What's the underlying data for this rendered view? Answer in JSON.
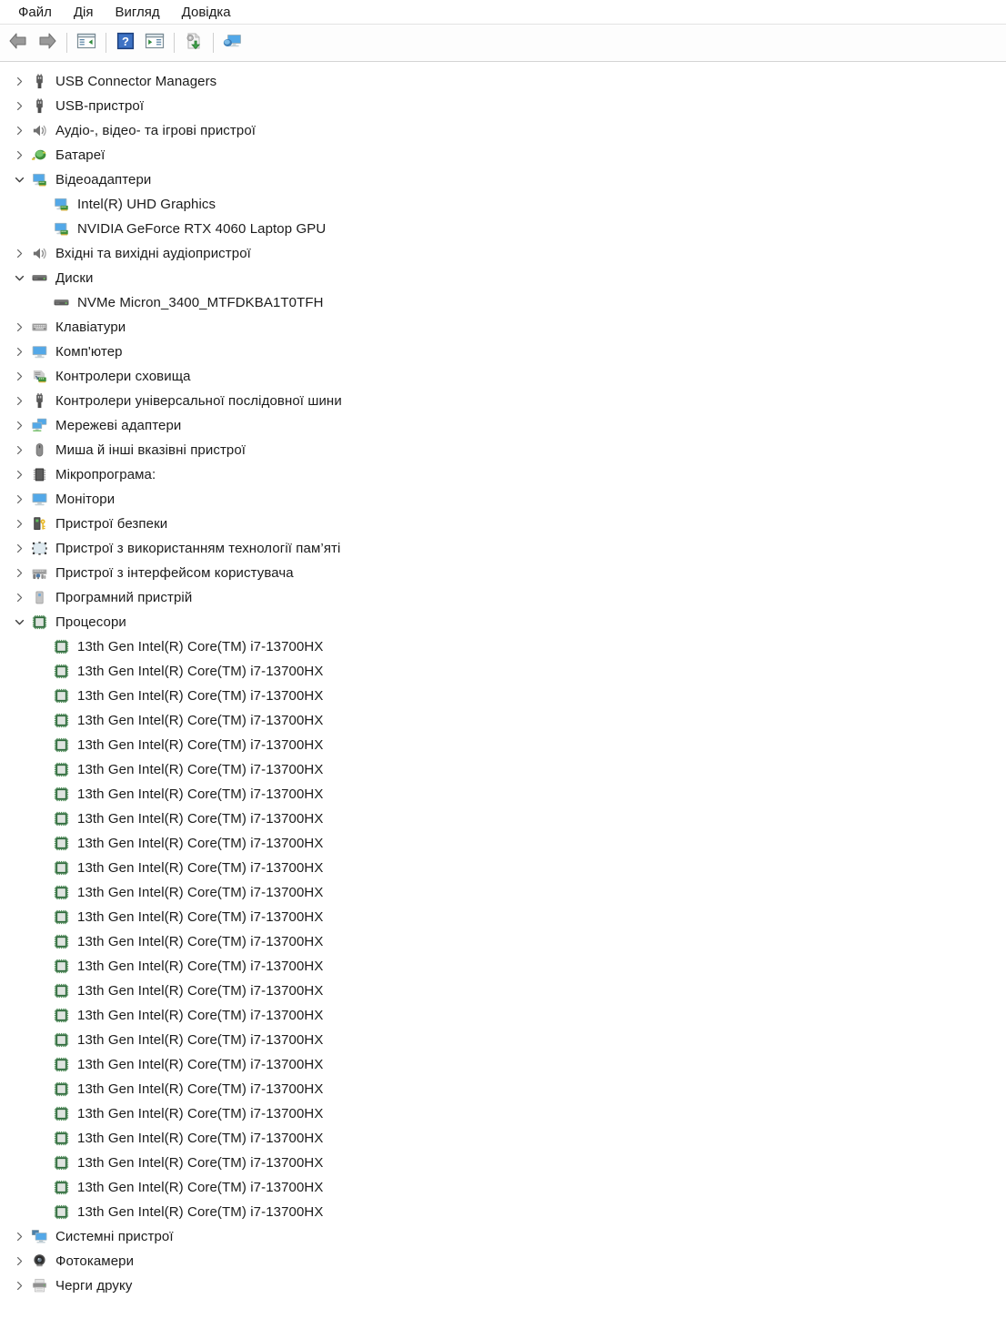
{
  "menubar": {
    "items": [
      {
        "label": "Файл",
        "name": "menu-file"
      },
      {
        "label": "Дія",
        "name": "menu-action"
      },
      {
        "label": "Вигляд",
        "name": "menu-view"
      },
      {
        "label": "Довідка",
        "name": "menu-help"
      }
    ]
  },
  "toolbar": {
    "buttons": [
      {
        "name": "back-button",
        "icon": "back-arrow-icon",
        "tooltip": "Назад"
      },
      {
        "name": "forward-button",
        "icon": "forward-arrow-icon",
        "tooltip": "Уперед"
      },
      {
        "name": "show-hide-tree-button",
        "icon": "tree-panel-icon",
        "tooltip": "Показати/сховати дерево консолі"
      },
      {
        "name": "help-button",
        "icon": "help-question-icon",
        "tooltip": "Довідка"
      },
      {
        "name": "properties-button",
        "icon": "properties-panel-icon",
        "tooltip": "Властивості"
      },
      {
        "name": "update-driver-button",
        "icon": "update-driver-icon",
        "tooltip": "Оновити драйвер"
      },
      {
        "name": "scan-hardware-button",
        "icon": "scan-hardware-icon",
        "tooltip": "Оновити конфігурацію обладнання"
      }
    ]
  },
  "colors": {
    "accent_blue": "#2f7fd1",
    "monitor_screen": "#53a8e8",
    "cpu_green": "#2f6b3c",
    "key_gold": "#e8b723",
    "battery_green": "#4a9b43",
    "text": "#1b1b1b",
    "chevron": "#636363",
    "hover_row": "#f2f7fc"
  },
  "tree": {
    "items": [
      {
        "label": "USB Connector Managers",
        "level": 0,
        "expander": "collapsed",
        "icon": "usb-connector-icon",
        "name": "tree-item-usb-connector-managers"
      },
      {
        "label": "USB-пристрої",
        "level": 0,
        "expander": "collapsed",
        "icon": "usb-connector-icon",
        "name": "tree-item-usb-devices"
      },
      {
        "label": "Аудіо-, відео- та ігрові пристрої",
        "level": 0,
        "expander": "collapsed",
        "icon": "speaker-icon",
        "name": "tree-item-audio-video-game-controllers"
      },
      {
        "label": "Батареї",
        "level": 0,
        "expander": "collapsed",
        "icon": "battery-plug-icon",
        "name": "tree-item-batteries"
      },
      {
        "label": "Відеоадаптери",
        "level": 0,
        "expander": "expanded",
        "icon": "display-adapter-icon",
        "name": "tree-item-display-adapters"
      },
      {
        "label": "Intel(R) UHD Graphics",
        "level": 1,
        "expander": "none",
        "icon": "display-adapter-icon",
        "name": "tree-item-intel-uhd-graphics"
      },
      {
        "label": "NVIDIA GeForce RTX 4060 Laptop GPU",
        "level": 1,
        "expander": "none",
        "icon": "display-adapter-icon",
        "name": "tree-item-nvidia-geforce-rtx-4060"
      },
      {
        "label": "Вхідні та вихідні аудіопристрої",
        "level": 0,
        "expander": "collapsed",
        "icon": "speaker-icon",
        "name": "tree-item-audio-inputs-outputs"
      },
      {
        "label": "Диски",
        "level": 0,
        "expander": "expanded",
        "icon": "disk-drive-icon",
        "name": "tree-item-disk-drives"
      },
      {
        "label": "NVMe Micron_3400_MTFDKBA1T0TFH",
        "level": 1,
        "expander": "none",
        "icon": "disk-drive-icon",
        "name": "tree-item-nvme-micron-3400"
      },
      {
        "label": "Клавіатури",
        "level": 0,
        "expander": "collapsed",
        "icon": "keyboard-icon",
        "name": "tree-item-keyboards"
      },
      {
        "label": "Комп'ютер",
        "level": 0,
        "expander": "collapsed",
        "icon": "computer-icon",
        "name": "tree-item-computer"
      },
      {
        "label": "Контролери сховища",
        "level": 0,
        "expander": "collapsed",
        "icon": "storage-controller-icon",
        "name": "tree-item-storage-controllers"
      },
      {
        "label": "Контролери універсальної послідовної шини",
        "level": 0,
        "expander": "collapsed",
        "icon": "usb-controller-icon",
        "name": "tree-item-usb-controllers"
      },
      {
        "label": "Мережеві адаптери",
        "level": 0,
        "expander": "collapsed",
        "icon": "network-adapter-icon",
        "name": "tree-item-network-adapters"
      },
      {
        "label": "Миша й інші вказівні пристрої",
        "level": 0,
        "expander": "collapsed",
        "icon": "mouse-icon",
        "name": "tree-item-mice-pointing-devices"
      },
      {
        "label": "Мікропрограма:",
        "level": 0,
        "expander": "collapsed",
        "icon": "firmware-chip-icon",
        "name": "tree-item-firmware"
      },
      {
        "label": "Монітори",
        "level": 0,
        "expander": "collapsed",
        "icon": "monitor-icon",
        "name": "tree-item-monitors"
      },
      {
        "label": "Пристрої безпеки",
        "level": 0,
        "expander": "collapsed",
        "icon": "security-key-icon",
        "name": "tree-item-security-devices"
      },
      {
        "label": "Пристрої з використанням технології пам’яті",
        "level": 0,
        "expander": "collapsed",
        "icon": "memory-technology-icon",
        "name": "tree-item-memory-technology-devices"
      },
      {
        "label": "Пристрої з інтерфейсом користувача",
        "level": 0,
        "expander": "collapsed",
        "icon": "hid-devices-icon",
        "name": "tree-item-human-interface-devices"
      },
      {
        "label": "Програмний пристрій",
        "level": 0,
        "expander": "collapsed",
        "icon": "software-device-icon",
        "name": "tree-item-software-devices"
      },
      {
        "label": "Процесори",
        "level": 0,
        "expander": "expanded",
        "icon": "processor-chip-icon",
        "name": "tree-item-processors"
      },
      {
        "label": "13th Gen Intel(R) Core(TM) i7-13700HX",
        "level": 1,
        "expander": "none",
        "icon": "processor-chip-icon",
        "name": "tree-item-processor-core"
      },
      {
        "label": "13th Gen Intel(R) Core(TM) i7-13700HX",
        "level": 1,
        "expander": "none",
        "icon": "processor-chip-icon",
        "name": "tree-item-processor-core"
      },
      {
        "label": "13th Gen Intel(R) Core(TM) i7-13700HX",
        "level": 1,
        "expander": "none",
        "icon": "processor-chip-icon",
        "name": "tree-item-processor-core"
      },
      {
        "label": "13th Gen Intel(R) Core(TM) i7-13700HX",
        "level": 1,
        "expander": "none",
        "icon": "processor-chip-icon",
        "name": "tree-item-processor-core"
      },
      {
        "label": "13th Gen Intel(R) Core(TM) i7-13700HX",
        "level": 1,
        "expander": "none",
        "icon": "processor-chip-icon",
        "name": "tree-item-processor-core"
      },
      {
        "label": "13th Gen Intel(R) Core(TM) i7-13700HX",
        "level": 1,
        "expander": "none",
        "icon": "processor-chip-icon",
        "name": "tree-item-processor-core"
      },
      {
        "label": "13th Gen Intel(R) Core(TM) i7-13700HX",
        "level": 1,
        "expander": "none",
        "icon": "processor-chip-icon",
        "name": "tree-item-processor-core"
      },
      {
        "label": "13th Gen Intel(R) Core(TM) i7-13700HX",
        "level": 1,
        "expander": "none",
        "icon": "processor-chip-icon",
        "name": "tree-item-processor-core"
      },
      {
        "label": "13th Gen Intel(R) Core(TM) i7-13700HX",
        "level": 1,
        "expander": "none",
        "icon": "processor-chip-icon",
        "name": "tree-item-processor-core"
      },
      {
        "label": "13th Gen Intel(R) Core(TM) i7-13700HX",
        "level": 1,
        "expander": "none",
        "icon": "processor-chip-icon",
        "name": "tree-item-processor-core"
      },
      {
        "label": "13th Gen Intel(R) Core(TM) i7-13700HX",
        "level": 1,
        "expander": "none",
        "icon": "processor-chip-icon",
        "name": "tree-item-processor-core"
      },
      {
        "label": "13th Gen Intel(R) Core(TM) i7-13700HX",
        "level": 1,
        "expander": "none",
        "icon": "processor-chip-icon",
        "name": "tree-item-processor-core"
      },
      {
        "label": "13th Gen Intel(R) Core(TM) i7-13700HX",
        "level": 1,
        "expander": "none",
        "icon": "processor-chip-icon",
        "name": "tree-item-processor-core"
      },
      {
        "label": "13th Gen Intel(R) Core(TM) i7-13700HX",
        "level": 1,
        "expander": "none",
        "icon": "processor-chip-icon",
        "name": "tree-item-processor-core"
      },
      {
        "label": "13th Gen Intel(R) Core(TM) i7-13700HX",
        "level": 1,
        "expander": "none",
        "icon": "processor-chip-icon",
        "name": "tree-item-processor-core"
      },
      {
        "label": "13th Gen Intel(R) Core(TM) i7-13700HX",
        "level": 1,
        "expander": "none",
        "icon": "processor-chip-icon",
        "name": "tree-item-processor-core"
      },
      {
        "label": "13th Gen Intel(R) Core(TM) i7-13700HX",
        "level": 1,
        "expander": "none",
        "icon": "processor-chip-icon",
        "name": "tree-item-processor-core"
      },
      {
        "label": "13th Gen Intel(R) Core(TM) i7-13700HX",
        "level": 1,
        "expander": "none",
        "icon": "processor-chip-icon",
        "name": "tree-item-processor-core"
      },
      {
        "label": "13th Gen Intel(R) Core(TM) i7-13700HX",
        "level": 1,
        "expander": "none",
        "icon": "processor-chip-icon",
        "name": "tree-item-processor-core"
      },
      {
        "label": "13th Gen Intel(R) Core(TM) i7-13700HX",
        "level": 1,
        "expander": "none",
        "icon": "processor-chip-icon",
        "name": "tree-item-processor-core"
      },
      {
        "label": "13th Gen Intel(R) Core(TM) i7-13700HX",
        "level": 1,
        "expander": "none",
        "icon": "processor-chip-icon",
        "name": "tree-item-processor-core"
      },
      {
        "label": "13th Gen Intel(R) Core(TM) i7-13700HX",
        "level": 1,
        "expander": "none",
        "icon": "processor-chip-icon",
        "name": "tree-item-processor-core"
      },
      {
        "label": "13th Gen Intel(R) Core(TM) i7-13700HX",
        "level": 1,
        "expander": "none",
        "icon": "processor-chip-icon",
        "name": "tree-item-processor-core"
      },
      {
        "label": "13th Gen Intel(R) Core(TM) i7-13700HX",
        "level": 1,
        "expander": "none",
        "icon": "processor-chip-icon",
        "name": "tree-item-processor-core"
      },
      {
        "label": "Системні пристрої",
        "level": 0,
        "expander": "collapsed",
        "icon": "system-devices-icon",
        "name": "tree-item-system-devices"
      },
      {
        "label": "Фотокамери",
        "level": 0,
        "expander": "collapsed",
        "icon": "camera-icon",
        "name": "tree-item-cameras"
      },
      {
        "label": "Черги друку",
        "level": 0,
        "expander": "collapsed",
        "icon": "printer-icon",
        "name": "tree-item-print-queues"
      }
    ]
  }
}
